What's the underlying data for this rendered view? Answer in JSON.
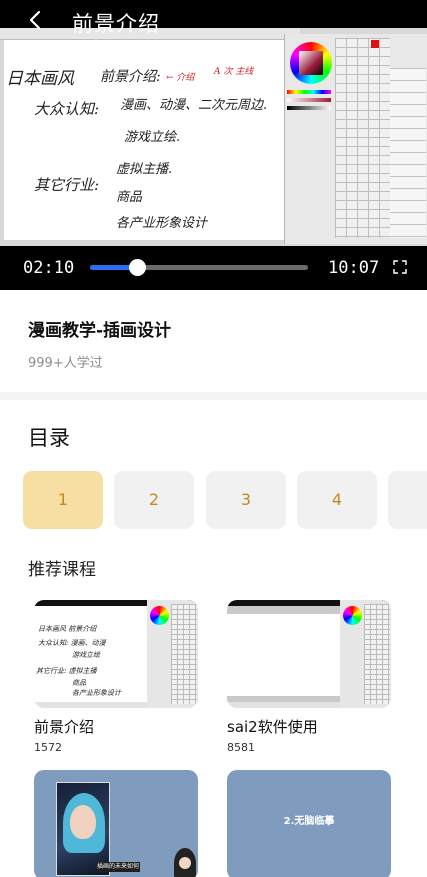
{
  "player": {
    "title": "前景介绍",
    "current_time": "02:10",
    "total_time": "10:07",
    "progress_fraction": 0.214,
    "board": {
      "heading": "日本画风",
      "subheading": "前景介绍:",
      "red_note_1": "← 介绍",
      "red_note_2": "A 次 主线",
      "line_public": "大众认知:",
      "item_1": "漫画、动漫、二次元周边.",
      "item_2": "游戏立绘.",
      "line_other": "其它行业:",
      "item_3": "虚拟主播.",
      "item_4": "商品",
      "item_5": "各产业形象设计"
    }
  },
  "course": {
    "title": "漫画教学-插画设计",
    "learners": "999+人学过"
  },
  "catalog": {
    "title": "目录",
    "chapters": [
      "1",
      "2",
      "3",
      "4",
      ""
    ]
  },
  "recommend": {
    "title": "推荐课程",
    "cards": [
      {
        "name": "前景介绍",
        "count": "1572",
        "thumb_lines": [
          "日本画风 前景介绍",
          "大众认知: 漫画、动漫",
          "游戏立绘",
          "其它行业: 虚拟主播",
          "商品",
          "各产业形象设计"
        ]
      },
      {
        "name": "sai2软件使用",
        "count": "8581"
      },
      {
        "caption": "插画的未来如何"
      },
      {
        "title": "2.无脑临摹"
      }
    ]
  },
  "colors": {
    "accent": "#2b6df5",
    "chapter_active": "#f7dfa3",
    "chapter_text": "#c08a1e",
    "card_blue": "#7f9bbd"
  },
  "icons": {
    "back": "chevron-left-icon",
    "pause": "pause-icon",
    "fullscreen": "fullscreen-icon"
  }
}
